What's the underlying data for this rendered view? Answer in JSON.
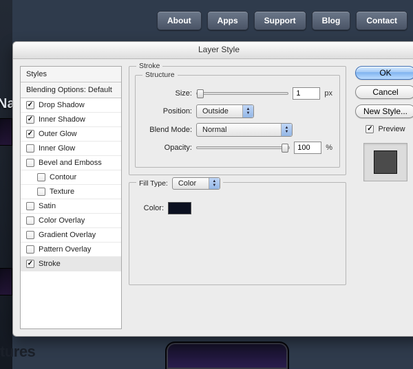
{
  "nav": {
    "items": [
      "About",
      "Apps",
      "Support",
      "Blog",
      "Contact"
    ]
  },
  "dialog": {
    "title": "Layer Style",
    "styles_header": "Styles",
    "blending_header": "Blending Options: Default",
    "style_items": [
      {
        "label": "Drop Shadow",
        "checked": true,
        "indent": false
      },
      {
        "label": "Inner Shadow",
        "checked": true,
        "indent": false
      },
      {
        "label": "Outer Glow",
        "checked": true,
        "indent": false
      },
      {
        "label": "Inner Glow",
        "checked": false,
        "indent": false
      },
      {
        "label": "Bevel and Emboss",
        "checked": false,
        "indent": false
      },
      {
        "label": "Contour",
        "checked": false,
        "indent": true
      },
      {
        "label": "Texture",
        "checked": false,
        "indent": true
      },
      {
        "label": "Satin",
        "checked": false,
        "indent": false
      },
      {
        "label": "Color Overlay",
        "checked": false,
        "indent": false
      },
      {
        "label": "Gradient Overlay",
        "checked": false,
        "indent": false
      },
      {
        "label": "Pattern Overlay",
        "checked": false,
        "indent": false
      },
      {
        "label": "Stroke",
        "checked": true,
        "indent": false,
        "selected": true
      }
    ],
    "panel_title": "Stroke",
    "structure": {
      "legend": "Structure",
      "size_label": "Size:",
      "size_value": "1",
      "size_unit": "px",
      "position_label": "Position:",
      "position_value": "Outside",
      "blend_label": "Blend Mode:",
      "blend_value": "Normal",
      "opacity_label": "Opacity:",
      "opacity_value": "100",
      "opacity_unit": "%"
    },
    "fill": {
      "legend": "Fill Type:",
      "type_value": "Color",
      "color_label": "Color:",
      "color_hex": "#0b1020"
    },
    "buttons": {
      "ok": "OK",
      "cancel": "Cancel",
      "new_style": "New Style..."
    },
    "preview": {
      "label": "Preview",
      "checked": true
    }
  },
  "bg": {
    "left_label": "Na",
    "bottom_text": "tures"
  }
}
